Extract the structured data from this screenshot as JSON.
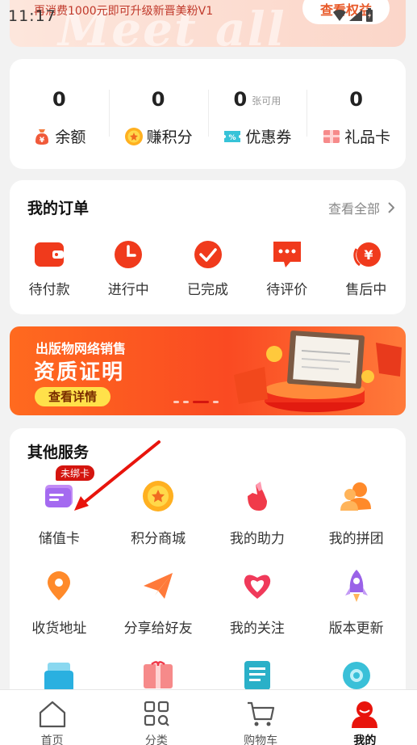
{
  "status_bar": {
    "time": "11:17"
  },
  "top": {
    "ghost_text": "Meet all",
    "upgrade_text": "再消费1000元即可升级新晋美粉V1",
    "rights_button": "查看权益"
  },
  "assets": [
    {
      "value": "0",
      "sub": "",
      "label": "余额",
      "icon": "wallet-bag-icon"
    },
    {
      "value": "0",
      "sub": "",
      "label": "赚积分",
      "icon": "coin-icon"
    },
    {
      "value": "0",
      "sub": "张可用",
      "label": "优惠券",
      "icon": "coupon-icon"
    },
    {
      "value": "0",
      "sub": "",
      "label": "礼品卡",
      "icon": "gift-card-icon"
    }
  ],
  "orders": {
    "title": "我的订单",
    "view_all": "查看全部",
    "items": [
      {
        "label": "待付款",
        "icon": "wallet-icon"
      },
      {
        "label": "进行中",
        "icon": "clock-icon"
      },
      {
        "label": "已完成",
        "icon": "check-icon"
      },
      {
        "label": "待评价",
        "icon": "comment-icon"
      },
      {
        "label": "售后中",
        "icon": "refund-icon"
      }
    ]
  },
  "banner": {
    "subtitle": "出版物网络销售",
    "title": "资质证明",
    "button": "查看详情",
    "dots": 4,
    "active_dot": 2
  },
  "services": {
    "title": "其他服务",
    "badge": "未绑卡",
    "items": [
      {
        "label": "储值卡",
        "icon": "stored-card-icon"
      },
      {
        "label": "积分商城",
        "icon": "points-mall-icon"
      },
      {
        "label": "我的助力",
        "icon": "boost-icon"
      },
      {
        "label": "我的拼团",
        "icon": "group-buy-icon"
      },
      {
        "label": "收货地址",
        "icon": "location-icon"
      },
      {
        "label": "分享给好友",
        "icon": "share-plane-icon"
      },
      {
        "label": "我的关注",
        "icon": "heart-icon"
      },
      {
        "label": "版本更新",
        "icon": "rocket-icon"
      },
      {
        "label": "",
        "icon": "folder-icon"
      },
      {
        "label": "",
        "icon": "gift-box-icon"
      },
      {
        "label": "",
        "icon": "document-icon"
      },
      {
        "label": "",
        "icon": "settings-icon"
      }
    ]
  },
  "tabbar": [
    {
      "label": "首页",
      "icon": "home-icon",
      "active": false
    },
    {
      "label": "分类",
      "icon": "category-icon",
      "active": false
    },
    {
      "label": "购物车",
      "icon": "cart-icon",
      "active": false
    },
    {
      "label": "我的",
      "icon": "profile-icon",
      "active": true
    }
  ],
  "colors": {
    "accent": "#e8392b",
    "banner": "#fa4a22",
    "badge": "#d4150f"
  }
}
